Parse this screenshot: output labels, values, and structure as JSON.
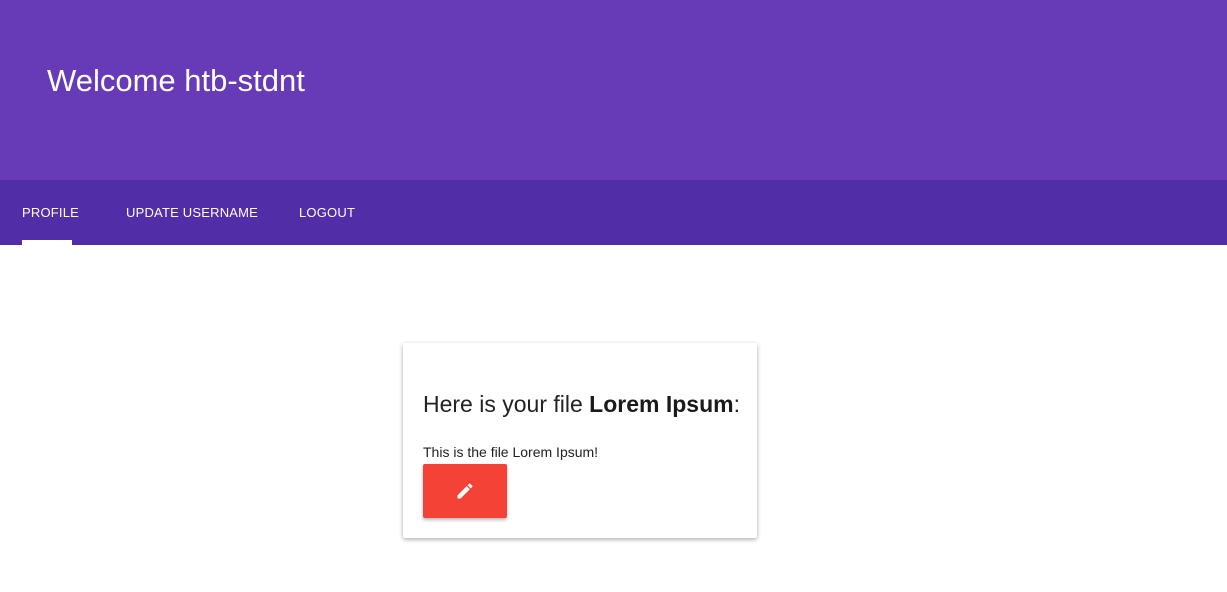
{
  "header": {
    "title": "Welcome htb-stdnt"
  },
  "tabs": [
    {
      "label": "PROFILE",
      "active": true
    },
    {
      "label": "UPDATE USERNAME",
      "active": false
    },
    {
      "label": "LOGOUT",
      "active": false
    }
  ],
  "card": {
    "heading_prefix": "Here is your file ",
    "heading_filename": "Lorem Ipsum",
    "heading_suffix": ":",
    "body_text": "This is the file Lorem Ipsum!",
    "edit_button_icon": "pencil-icon"
  },
  "colors": {
    "header": "#673ab7",
    "tabs_bar": "#512da8",
    "edit_button": "#f44336"
  }
}
